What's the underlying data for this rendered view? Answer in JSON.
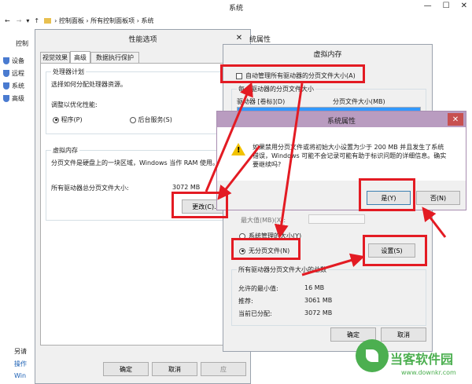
{
  "system_window": {
    "title": "系统",
    "breadcrumb": [
      "控制面板",
      "所有控制面板项",
      "系统"
    ],
    "sidebar_top": "控制",
    "sidebar_items": [
      "设备",
      "远程",
      "系统",
      "高级"
    ],
    "sidebar_bottom": [
      "另请",
      "操作",
      "Win"
    ]
  },
  "perf_dialog": {
    "title": "性能选项",
    "tabs": [
      "视觉效果",
      "高级",
      "数据执行保护"
    ],
    "processor_group": "处理器计划",
    "processor_desc": "选择如何分配处理器资源。",
    "optimize_label": "调整以优化性能:",
    "option_programs": "程序(P)",
    "option_background": "后台服务(S)",
    "vm_group": "虚拟内存",
    "vm_desc": "分页文件是硬盘上的一块区域，Windows 当作 RAM 使用。",
    "vm_total_label": "所有驱动器总分页文件大小:",
    "vm_total_value": "3072 MB",
    "change_button": "更改(C)...",
    "ok_button": "确定",
    "cancel_button": "取消",
    "apply_button": "应"
  },
  "sysprops_back": {
    "title_fragment": "统属性"
  },
  "vm_dialog": {
    "title": "虚拟内存",
    "auto_manage": "自动管理所有驱动器的分页文件大小(A)",
    "per_drive_label": "每个驱动器的分页文件大小",
    "col_drive": "驱动器 [卷标](D)",
    "col_size": "分页文件大小(MB)",
    "max_size_label": "最大值(MB)(X):",
    "system_managed": "系统管理的大小(Y)",
    "no_paging": "无分页文件(N)",
    "set_button": "设置(S)",
    "totals_group": "所有驱动器分页文件大小的总数",
    "min_allowed_label": "允许的最小值:",
    "min_allowed_value": "16 MB",
    "recommended_label": "推荐:",
    "recommended_value": "3061 MB",
    "current_label": "当前已分配:",
    "current_value": "3072 MB",
    "ok_button": "确定",
    "cancel_button": "取消"
  },
  "warning_dialog": {
    "title": "系统属性",
    "message": "如果禁用分页文件或将初始大小设置为少于 200 MB 并且发生了系统错误，Windows 可能不会记录可能有助于标识问题的详细信息。确实要继续吗?",
    "yes_button": "是(Y)",
    "no_button": "否(N)"
  },
  "watermark": {
    "line1": "当客软件园",
    "line2": "www.downkr.com"
  },
  "colors": {
    "annotation_red": "#e31b23",
    "warning_title_bg": "#b99cc0",
    "selected_row": "#3399ff",
    "watermark_green": "#4caf50"
  }
}
